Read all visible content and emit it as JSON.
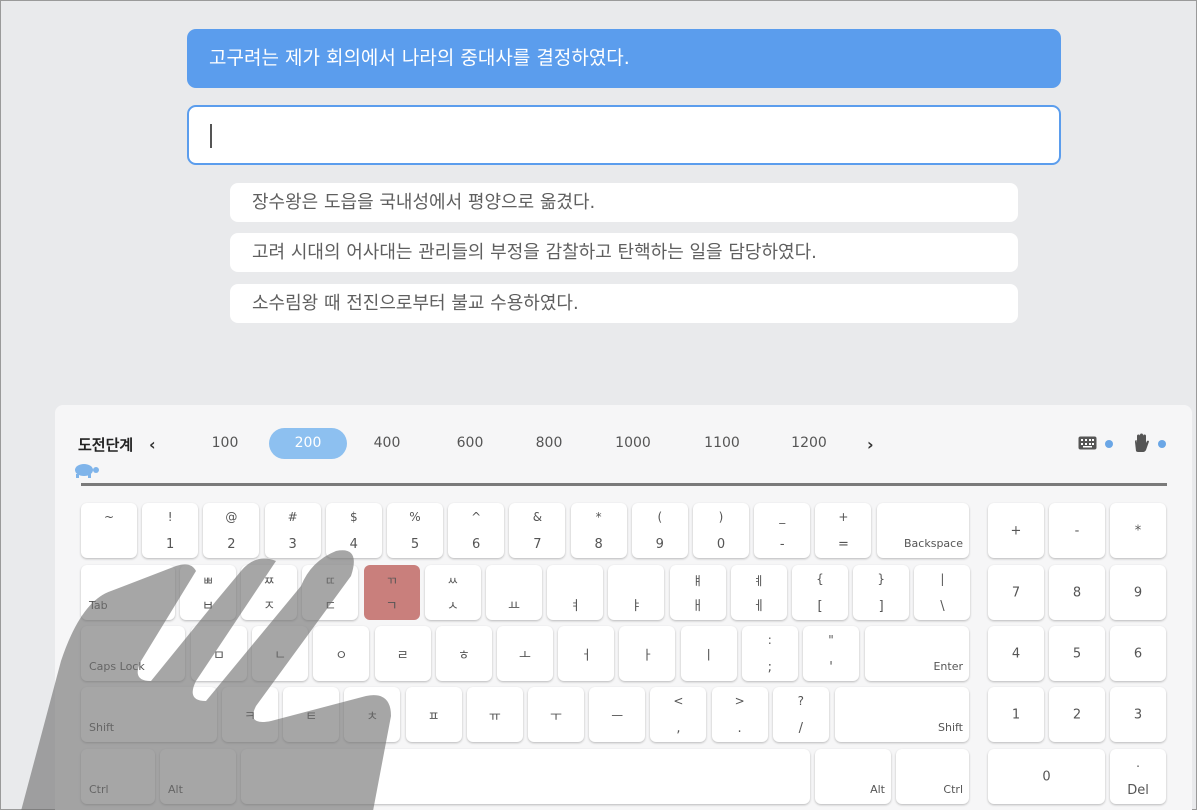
{
  "current_sentence": "고구려는 제가 회의에서 나라의 중대사를 결정하였다.",
  "input": {
    "value": "",
    "placeholder": ""
  },
  "upcoming": [
    "장수왕은 도읍을 국내성에서 평양으로 옮겼다.",
    "고려 시대의 어사대는 관리들의 부정을 감찰하고 탄핵하는 일을 담당하였다.",
    "소수림왕 때 전진으로부터 불교 수용하였다."
  ],
  "levels": {
    "title": "도전단계",
    "items": [
      "100",
      "200",
      "400",
      "600",
      "800",
      "1000",
      "1100",
      "1200"
    ],
    "active": "200"
  },
  "toggles": {
    "keyboard_icon": "keyboard-icon",
    "hand_icon": "hand-icon",
    "mascot_icon": "turtle-icon"
  },
  "colors": {
    "accent": "#5b9ded",
    "highlight_key": "#c97f7c",
    "active_level": "#8dc0f0"
  },
  "keyboard": {
    "row1": [
      {
        "t": "~",
        "b": ""
      },
      {
        "t": "!",
        "b": "1"
      },
      {
        "t": "@",
        "b": "2"
      },
      {
        "t": "#",
        "b": "3"
      },
      {
        "t": "$",
        "b": "4"
      },
      {
        "t": "%",
        "b": "5"
      },
      {
        "t": "^",
        "b": "6"
      },
      {
        "t": "&",
        "b": "7"
      },
      {
        "t": "*",
        "b": "8"
      },
      {
        "t": "(",
        "b": "9"
      },
      {
        "t": ")",
        "b": "0"
      },
      {
        "t": "_",
        "b": "-"
      },
      {
        "t": "+",
        "b": "="
      }
    ],
    "backspace": "Backspace",
    "tab": "Tab",
    "row2": [
      {
        "t": "ㅃ",
        "b": "ㅂ"
      },
      {
        "t": "ㅉ",
        "b": "ㅈ"
      },
      {
        "t": "ㄸ",
        "b": "ㄷ"
      },
      {
        "t": "ㄲ",
        "b": "ㄱ"
      },
      {
        "t": "ㅆ",
        "b": "ㅅ"
      },
      {
        "t": "",
        "b": "ㅛ"
      },
      {
        "t": "",
        "b": "ㅕ"
      },
      {
        "t": "",
        "b": "ㅑ"
      },
      {
        "t": "ㅒ",
        "b": "ㅐ"
      },
      {
        "t": "ㅖ",
        "b": "ㅔ"
      },
      {
        "t": "{",
        "b": "["
      },
      {
        "t": "}",
        "b": "]"
      },
      {
        "t": "|",
        "b": "\\"
      }
    ],
    "caps": "Caps Lock",
    "row3": [
      {
        "t": "",
        "b": "ㅁ"
      },
      {
        "t": "",
        "b": "ㄴ"
      },
      {
        "t": "",
        "b": "ㅇ"
      },
      {
        "t": "",
        "b": "ㄹ"
      },
      {
        "t": "",
        "b": "ㅎ"
      },
      {
        "t": "",
        "b": "ㅗ"
      },
      {
        "t": "",
        "b": "ㅓ"
      },
      {
        "t": "",
        "b": "ㅏ"
      },
      {
        "t": "",
        "b": "ㅣ"
      },
      {
        "t": ":",
        "b": ";"
      },
      {
        "t": "\"",
        "b": "'"
      }
    ],
    "enter": "Enter",
    "shift_l": "Shift",
    "row4": [
      {
        "t": "",
        "b": "ㅋ"
      },
      {
        "t": "",
        "b": "ㅌ"
      },
      {
        "t": "",
        "b": "ㅊ"
      },
      {
        "t": "",
        "b": "ㅍ"
      },
      {
        "t": "",
        "b": "ㅠ"
      },
      {
        "t": "",
        "b": "ㅜ"
      },
      {
        "t": "",
        "b": "ㅡ"
      },
      {
        "t": "<",
        "b": ","
      },
      {
        "t": ">",
        "b": "."
      },
      {
        "t": "?",
        "b": "/"
      }
    ],
    "shift_r": "Shift",
    "ctrl_l": "Ctrl",
    "alt_l": "Alt",
    "alt_r": "Alt",
    "ctrl_r": "Ctrl",
    "numpad": {
      "r1": [
        "+",
        "-",
        "*"
      ],
      "r2": [
        "7",
        "8",
        "9"
      ],
      "r3": [
        "4",
        "5",
        "6"
      ],
      "r4": [
        "1",
        "2",
        "3"
      ],
      "zero": "0",
      "del_top": ".",
      "del": "Del"
    }
  }
}
